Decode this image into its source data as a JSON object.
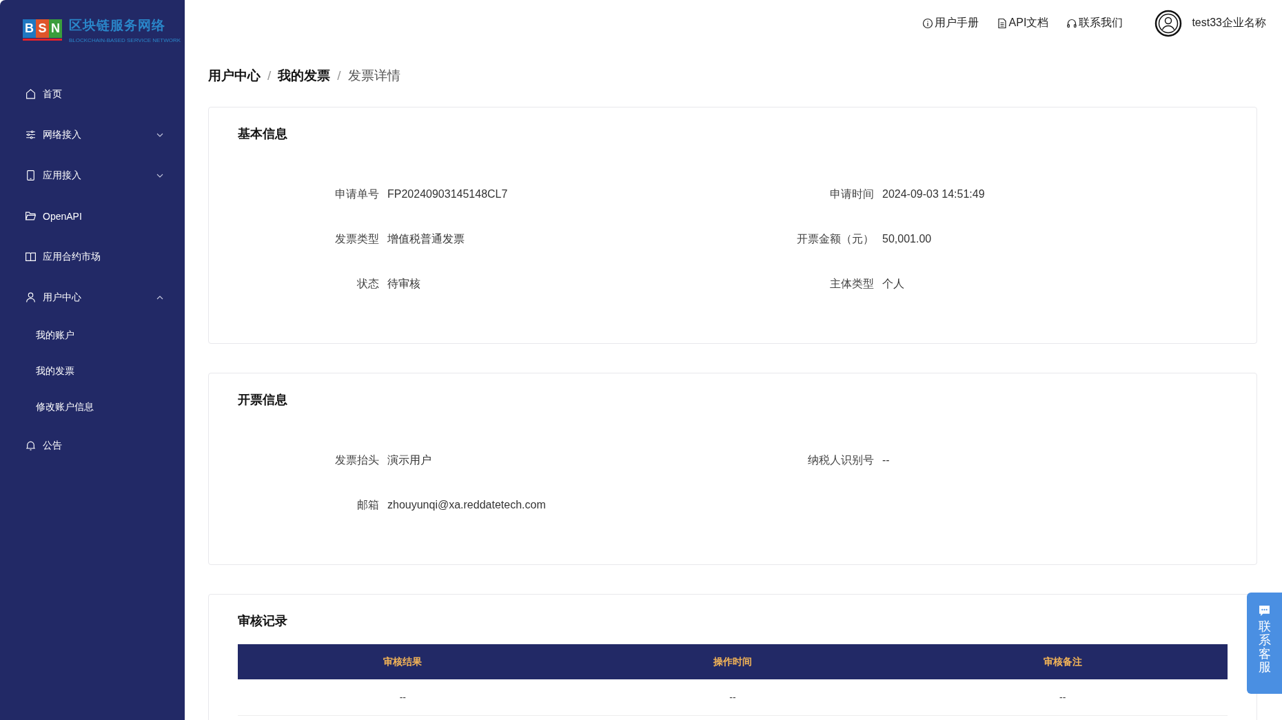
{
  "logo": {
    "letters": [
      "B",
      "S",
      "N"
    ],
    "title": "区块链服务网络",
    "subtitle": "BLOCKCHAIN-BASED SERVICE NETWORK"
  },
  "sidebar": {
    "items": [
      {
        "label": "首页"
      },
      {
        "label": "网络接入",
        "expanded": false
      },
      {
        "label": "应用接入",
        "expanded": false
      },
      {
        "label": "OpenAPI"
      },
      {
        "label": "应用合约市场"
      },
      {
        "label": "用户中心",
        "expanded": true,
        "children": [
          {
            "label": "我的账户"
          },
          {
            "label": "我的发票"
          },
          {
            "label": "修改账户信息"
          }
        ]
      },
      {
        "label": "公告"
      }
    ]
  },
  "header": {
    "links": [
      {
        "label": "用户手册"
      },
      {
        "label": "API文档"
      },
      {
        "label": "联系我们"
      }
    ],
    "user": "test33企业名称"
  },
  "breadcrumb": [
    {
      "label": "用户中心"
    },
    {
      "separator": "/",
      "label": "我的发票"
    },
    {
      "separator": "/",
      "label": "发票详情"
    }
  ],
  "sections": [
    {
      "title": "基本信息",
      "fields": [
        {
          "label": "申请单号",
          "value": "FP20240903145148CL7"
        },
        {
          "label": "申请时间",
          "value": "2024-09-03 14:51:49"
        },
        {
          "label": "发票类型",
          "value": "增值税普通发票"
        },
        {
          "label": "开票金额（元）",
          "value": "50,001.00"
        },
        {
          "label": "状态",
          "value": "待审核"
        },
        {
          "label": "主体类型",
          "value": "个人"
        }
      ]
    },
    {
      "title": "开票信息",
      "fields": [
        {
          "label": "发票抬头",
          "value": "演示用户"
        },
        {
          "label": "纳税人识别号",
          "value": "--"
        },
        {
          "label": "邮箱",
          "value": "zhouyunqi@xa.reddatetech.com"
        }
      ]
    }
  ],
  "review": {
    "title": "审核记录",
    "columns": [
      "审核结果",
      "操作时间",
      "审核备注"
    ],
    "rows": [
      [
        "--",
        "--",
        "--"
      ]
    ]
  },
  "float_button": {
    "label": "联系客服"
  }
}
